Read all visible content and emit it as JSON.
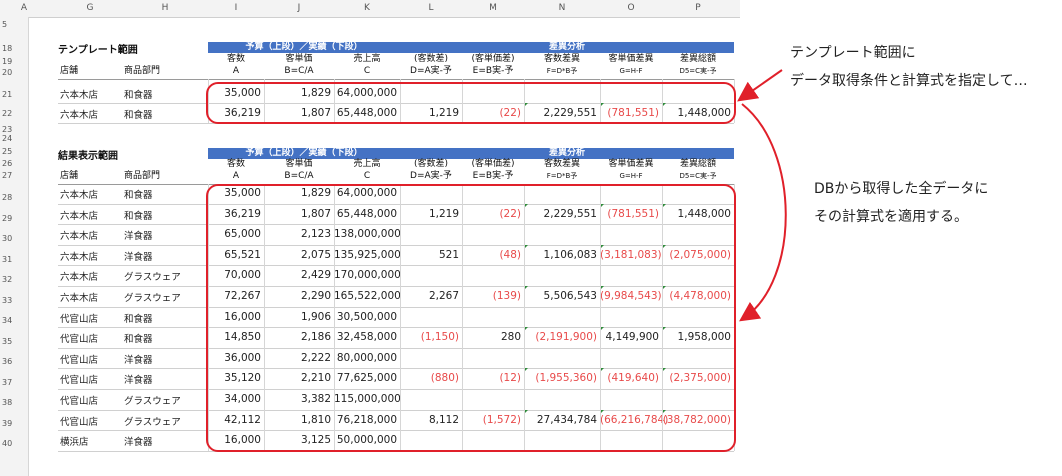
{
  "columns": [
    "A",
    "G",
    "H",
    "I",
    "J",
    "K",
    "L",
    "M",
    "N",
    "O",
    "P"
  ],
  "rows": [
    "5",
    "18",
    "19",
    "20",
    "21",
    "22",
    "23",
    "24",
    "25",
    "26",
    "27",
    "28",
    "29",
    "30",
    "31",
    "32",
    "33",
    "34",
    "35",
    "36",
    "37",
    "38",
    "39",
    "40"
  ],
  "template": {
    "title": "テンプレート範囲",
    "band_left": "予算（上段）／実績（下段）",
    "band_right": "差異分析",
    "headers": [
      {
        "l1": "",
        "l2": "店舗"
      },
      {
        "l1": "",
        "l2": "商品部門"
      },
      {
        "l1": "客数",
        "l2": "A"
      },
      {
        "l1": "客単価",
        "l2": "B=C/A"
      },
      {
        "l1": "売上高",
        "l2": "C"
      },
      {
        "l1": "(客数差)",
        "l2": "D=A実-予"
      },
      {
        "l1": "(客単価差)",
        "l2": "E=B実-予"
      },
      {
        "l1": "客数差異",
        "l2": "F=D*B予"
      },
      {
        "l1": "客単価差異",
        "l2": "G=H-F"
      },
      {
        "l1": "差異総額",
        "l2": "D5=C実-予"
      }
    ],
    "rows": [
      [
        "六本木店",
        "和食器",
        "35,000",
        "1,829",
        "64,000,000",
        "",
        "",
        "",
        "",
        ""
      ],
      [
        "六本木店",
        "和食器",
        "36,219",
        "1,807",
        "65,448,000",
        "1,219",
        "(22)",
        "2,229,551",
        "(781,551)",
        "1,448,000"
      ]
    ]
  },
  "result": {
    "title": "結果表示範囲",
    "band_left": "予算（上段）／実績（下段）",
    "band_right": "差異分析",
    "headers": [
      {
        "l1": "",
        "l2": "店舗"
      },
      {
        "l1": "",
        "l2": "商品部門"
      },
      {
        "l1": "客数",
        "l2": "A"
      },
      {
        "l1": "客単価",
        "l2": "B=C/A"
      },
      {
        "l1": "売上高",
        "l2": "C"
      },
      {
        "l1": "(客数差)",
        "l2": "D=A実-予"
      },
      {
        "l1": "(客単価差)",
        "l2": "E=B実-予"
      },
      {
        "l1": "客数差異",
        "l2": "F=D*B予"
      },
      {
        "l1": "客単価差異",
        "l2": "G=H-F"
      },
      {
        "l1": "差異総額",
        "l2": "D5=C実-予"
      }
    ],
    "rows": [
      [
        "六本木店",
        "和食器",
        "35,000",
        "1,829",
        "64,000,000",
        "",
        "",
        "",
        "",
        ""
      ],
      [
        "六本木店",
        "和食器",
        "36,219",
        "1,807",
        "65,448,000",
        "1,219",
        "(22)",
        "2,229,551",
        "(781,551)",
        "1,448,000"
      ],
      [
        "六本木店",
        "洋食器",
        "65,000",
        "2,123",
        "138,000,000",
        "",
        "",
        "",
        "",
        ""
      ],
      [
        "六本木店",
        "洋食器",
        "65,521",
        "2,075",
        "135,925,000",
        "521",
        "(48)",
        "1,106,083",
        "(3,181,083)",
        "(2,075,000)"
      ],
      [
        "六本木店",
        "グラスウェア",
        "70,000",
        "2,429",
        "170,000,000",
        "",
        "",
        "",
        "",
        ""
      ],
      [
        "六本木店",
        "グラスウェア",
        "72,267",
        "2,290",
        "165,522,000",
        "2,267",
        "(139)",
        "5,506,543",
        "(9,984,543)",
        "(4,478,000)"
      ],
      [
        "代官山店",
        "和食器",
        "16,000",
        "1,906",
        "30,500,000",
        "",
        "",
        "",
        "",
        ""
      ],
      [
        "代官山店",
        "和食器",
        "14,850",
        "2,186",
        "32,458,000",
        "(1,150)",
        "280",
        "(2,191,900)",
        "4,149,900",
        "1,958,000"
      ],
      [
        "代官山店",
        "洋食器",
        "36,000",
        "2,222",
        "80,000,000",
        "",
        "",
        "",
        "",
        ""
      ],
      [
        "代官山店",
        "洋食器",
        "35,120",
        "2,210",
        "77,625,000",
        "(880)",
        "(12)",
        "(1,955,360)",
        "(419,640)",
        "(2,375,000)"
      ],
      [
        "代官山店",
        "グラスウェア",
        "34,000",
        "3,382",
        "115,000,000",
        "",
        "",
        "",
        "",
        ""
      ],
      [
        "代官山店",
        "グラスウェア",
        "42,112",
        "1,810",
        "76,218,000",
        "8,112",
        "(1,572)",
        "27,434,784",
        "(66,216,784)",
        "(38,782,000)"
      ],
      [
        "横浜店",
        "洋食器",
        "16,000",
        "3,125",
        "50,000,000",
        "",
        "",
        "",
        "",
        ""
      ]
    ]
  },
  "annotations": {
    "top_line1": "テンプレート範囲に",
    "top_line2": "データ取得条件と計算式を指定して…",
    "mid_line1": "DBから取得した全データに",
    "mid_line2": "その計算式を適用する。"
  },
  "colors": {
    "band": "#4472c4",
    "negative": "#e84a4a",
    "highlight": "#e0202a",
    "arrow": "#e0202a"
  }
}
